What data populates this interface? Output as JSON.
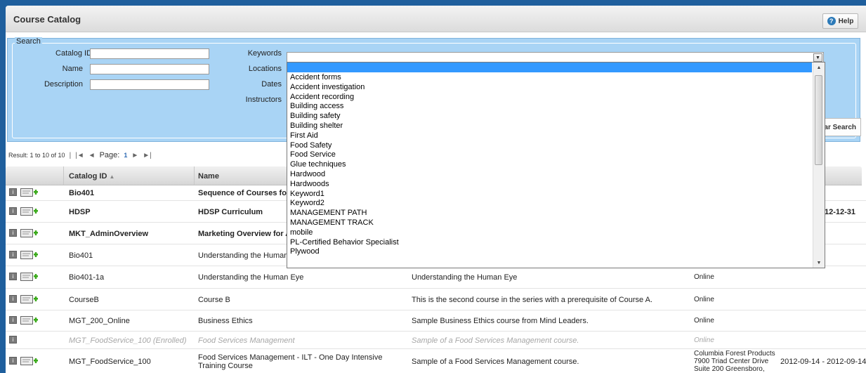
{
  "header": {
    "title": "Course Catalog",
    "help_label": "Help"
  },
  "search": {
    "legend": "Search",
    "catalog_id_label": "Catalog ID",
    "name_label": "Name",
    "description_label": "Description",
    "keywords_label": "Keywords",
    "locations_label": "Locations",
    "dates_label": "Dates",
    "instructors_label": "Instructors",
    "clear_search_label": "ar Search",
    "keyword_options": [
      "Accident forms",
      "Accident investigation",
      "Accident recording",
      "Building access",
      "Building safety",
      "Building shelter",
      "First Aid",
      "Food Safety",
      "Food Service",
      "Glue techniques",
      "Hardwood",
      "Hardwoods",
      "Keyword1",
      "Keyword2",
      "MANAGEMENT PATH",
      "MANAGEMENT TRACK",
      "mobile",
      "PL-Certified Behavior Specialist",
      "Plywood"
    ]
  },
  "results": {
    "summary": "Result: 1 to 10 of 10",
    "page_label": "Page:",
    "page_number": "1"
  },
  "table": {
    "headers": {
      "catalog_id": "Catalog ID",
      "name": "Name"
    },
    "rows": [
      {
        "id": "Bio401",
        "name": "Sequence of Courses for",
        "desc": "",
        "location": "",
        "dates": "",
        "bold": true
      },
      {
        "id": "HDSP",
        "name": "HDSP Curriculum",
        "desc": "",
        "location": "",
        "dates": "- 2012-12-31",
        "bold": true
      },
      {
        "id": "MKT_AdminOverview",
        "name": "Marketing Overview for A",
        "desc": "",
        "location": "",
        "dates": "",
        "bold": true
      },
      {
        "id": "Bio401",
        "name": "Understanding the Human Ey",
        "desc": "",
        "location": "",
        "dates": ""
      },
      {
        "id": "Bio401-1a",
        "name": "Understanding the Human Eye",
        "desc": "Understanding the Human Eye",
        "location": "Online",
        "dates": ""
      },
      {
        "id": "CourseB",
        "name": "Course B",
        "desc": "This is the second course in the series with a prerequisite of Course A.",
        "location": "Online",
        "dates": ""
      },
      {
        "id": "MGT_200_Online",
        "name": "Business Ethics",
        "desc": "Sample Business Ethics course from Mind Leaders.",
        "location": "Online",
        "dates": ""
      },
      {
        "id": "MGT_FoodService_100 (Enrolled)",
        "name": "Food Services Management",
        "desc": "Sample of a Food Services Management course.",
        "location": "Online",
        "dates": "",
        "dim": true
      },
      {
        "id": "MGT_FoodService_100",
        "name": "Food Services Management - ILT - One Day Intensive Training Course",
        "desc": "Sample of a Food Services Management course.",
        "location": "Columbia Forest Products 7900 Triad Center Drive Suite 200 Greensboro,",
        "dates": "2012-09-14 - 2012-09-14"
      }
    ]
  },
  "colors": {
    "panel": "#a9d4f5",
    "frame": "#1f5f9d",
    "highlight": "#3399ff"
  }
}
